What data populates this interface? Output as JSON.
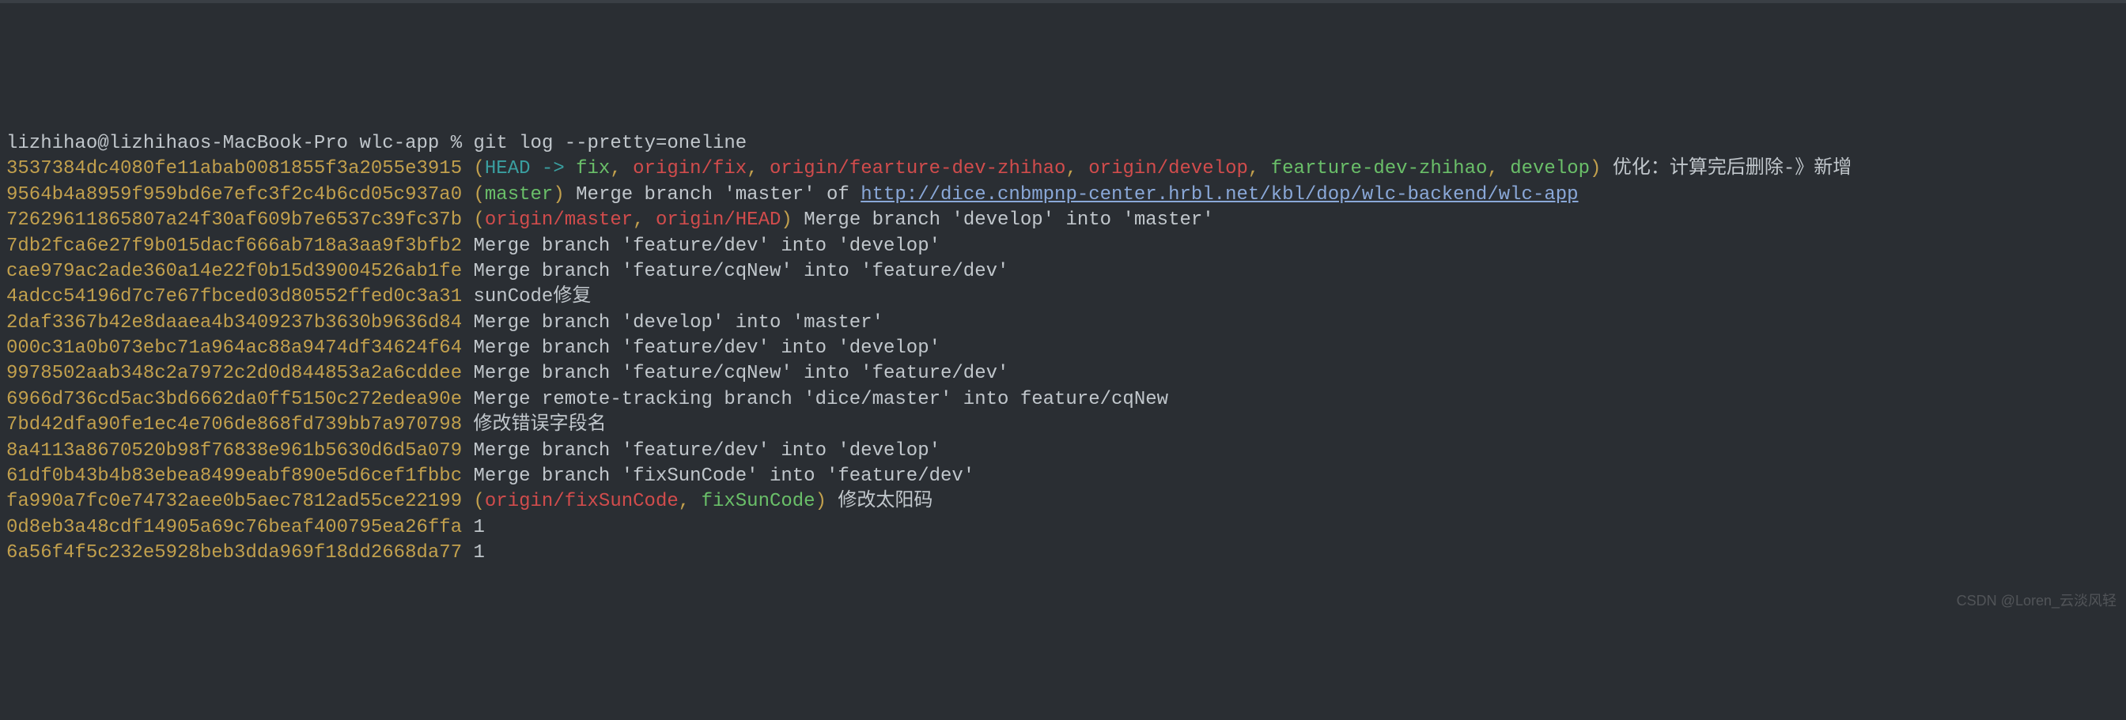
{
  "prompt": {
    "user_host": "lizhihao@lizhihaos-MacBook-Pro",
    "cwd": "wlc-app",
    "symbol": "%",
    "command": "git log --pretty=oneline"
  },
  "commits": [
    {
      "hash": "3537384dc4080fe11abab0081855f3a2055e3915",
      "refs": {
        "head_arrow": "HEAD -> ",
        "head_branch": "fix",
        "remotes": [
          "origin/fix",
          "origin/fearture-dev-zhihao",
          "origin/develop"
        ],
        "locals": [
          "fearture-dev-zhihao",
          "develop"
        ]
      },
      "msg": "优化：计算完后删除-》新增"
    },
    {
      "hash": "9564b4a8959f959bd6e7efc3f2c4b6cd05c937a0",
      "refs": {
        "locals": [
          "master"
        ]
      },
      "msg_pre": "Merge branch 'master' of ",
      "link": "http://dice.cnbmpnp-center.hrbl.net/kbl/dop/wlc-backend/wlc-app"
    },
    {
      "hash": "72629611865807a24f30af609b7e6537c39fc37b",
      "refs": {
        "remotes": [
          "origin/master",
          "origin/HEAD"
        ]
      },
      "msg": "Merge branch 'develop' into 'master'"
    },
    {
      "hash": "7db2fca6e27f9b015dacf666ab718a3aa9f3bfb2",
      "msg": "Merge branch 'feature/dev' into 'develop'"
    },
    {
      "hash": "cae979ac2ade360a14e22f0b15d39004526ab1fe",
      "msg": "Merge branch 'feature/cqNew' into 'feature/dev'"
    },
    {
      "hash": "4adcc54196d7c7e67fbced03d80552ffed0c3a31",
      "msg": "sunCode修复"
    },
    {
      "hash": "2daf3367b42e8daaea4b3409237b3630b9636d84",
      "msg": "Merge branch 'develop' into 'master'"
    },
    {
      "hash": "000c31a0b073ebc71a964ac88a9474df34624f64",
      "msg": "Merge branch 'feature/dev' into 'develop'"
    },
    {
      "hash": "9978502aab348c2a7972c2d0d844853a2a6cddee",
      "msg": "Merge branch 'feature/cqNew' into 'feature/dev'"
    },
    {
      "hash": "6966d736cd5ac3bd6662da0ff5150c272edea90e",
      "msg": "Merge remote-tracking branch 'dice/master' into feature/cqNew"
    },
    {
      "hash": "7bd42dfa90fe1ec4e706de868fd739bb7a970798",
      "msg": "修改错误字段名"
    },
    {
      "hash": "8a4113a8670520b98f76838e961b5630d6d5a079",
      "msg": "Merge branch 'feature/dev' into 'develop'"
    },
    {
      "hash": "61df0b43b4b83ebea8499eabf890e5d6cef1fbbc",
      "msg": "Merge branch 'fixSunCode' into 'feature/dev'"
    },
    {
      "hash": "fa990a7fc0e74732aee0b5aec7812ad55ce22199",
      "refs": {
        "remotes": [
          "origin/fixSunCode"
        ],
        "locals": [
          "fixSunCode"
        ]
      },
      "msg": "修改太阳码"
    },
    {
      "hash": "0d8eb3a48cdf14905a69c76beaf400795ea26ffa",
      "msg": "1"
    },
    {
      "hash": "6a56f4f5c232e5928beb3dda969f18dd2668da77",
      "msg": "1"
    }
  ],
  "watermark": "CSDN @Loren_云淡风轻"
}
